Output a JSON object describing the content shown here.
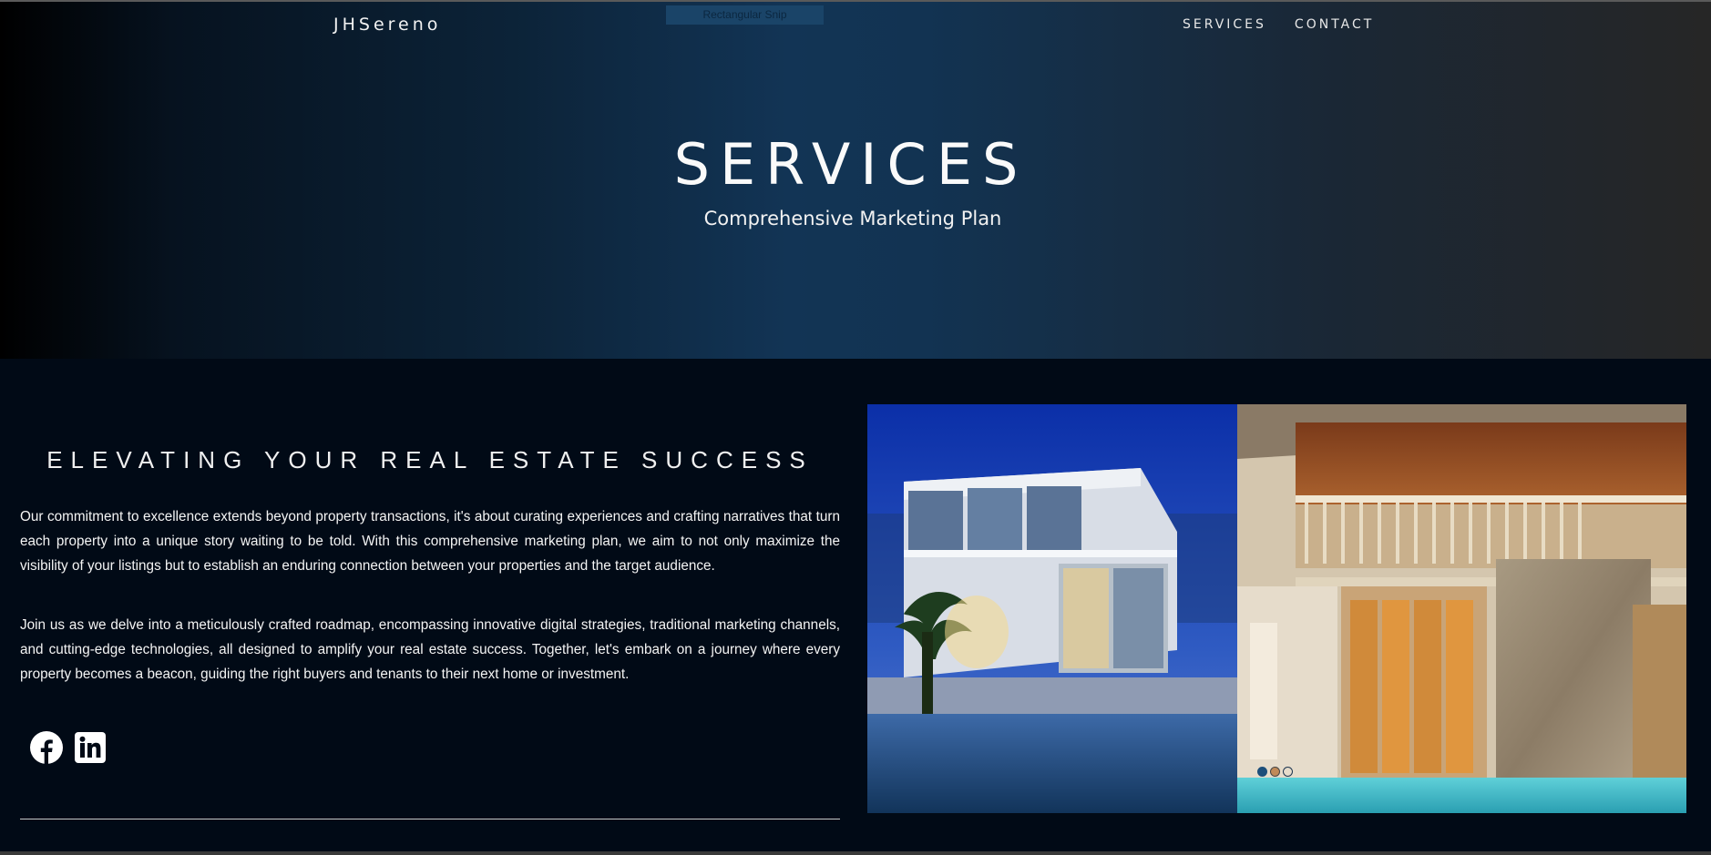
{
  "site": {
    "brand": "JHSereno",
    "overlay_label": "Rectangular Snip"
  },
  "nav": {
    "items": [
      {
        "label": "SERVICES"
      },
      {
        "label": "CONTACT"
      }
    ]
  },
  "hero": {
    "title": "SERVICES",
    "subtitle": "Comprehensive Marketing Plan"
  },
  "section": {
    "heading": "ELEVATING YOUR REAL ESTATE SUCCESS",
    "paragraphs": [
      "Our commitment to excellence extends beyond property transactions, it's about curating experiences and crafting narratives that turn each property into a unique story waiting to be told. With this comprehensive marketing plan, we aim to not only maximize the visibility of your listings but to establish an enduring connection between your properties and the target audience.",
      "Join us as we delve into a meticulously crafted roadmap, encompassing innovative digital strategies, traditional marketing channels, and cutting-edge technologies, all designed to amplify your real estate success. Together, let's embark on a journey where every property becomes a beacon, guiding the right buyers and tenants to their next home or investment."
    ]
  },
  "social": {
    "icons": [
      "facebook-icon",
      "linkedin-icon"
    ]
  },
  "carousel": {
    "slide_count": 3,
    "active_index": 0
  },
  "colors": {
    "page_bg": "#010a16",
    "hero_accent": "#123455",
    "dot_active": "#1d4f7a"
  }
}
